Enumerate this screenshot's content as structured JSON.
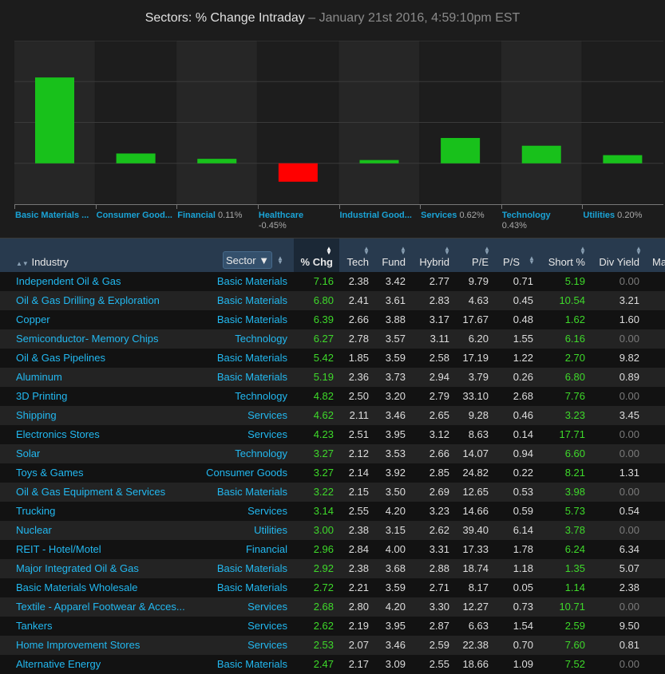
{
  "title": {
    "main": "Sectors: % Change Intraday",
    "separator": " – ",
    "sub": "January 21st 2016, 4:59:10pm EST"
  },
  "chart_data": {
    "type": "bar",
    "ylim": [
      -1,
      3
    ],
    "grid": true,
    "colors": {
      "positive": "#18c11b",
      "negative": "#ff0000"
    },
    "categories": [
      "Basic Materials ...",
      "Consumer Good...",
      "Financial",
      "Healthcare",
      "Industrial Good...",
      "Services",
      "Technology",
      "Utilities"
    ],
    "value_labels": [
      "",
      "",
      "0.11%",
      "-0.45%",
      "",
      "0.62%",
      "0.43%",
      "0.20%"
    ],
    "values": [
      2.1,
      0.24,
      0.11,
      -0.45,
      0.08,
      0.62,
      0.43,
      0.2
    ]
  },
  "table": {
    "headers": {
      "industry": "Industry",
      "sector": "Sector",
      "chg": "% Chg",
      "tech": "Tech",
      "fund": "Fund",
      "hybrid": "Hybrid",
      "pe": "P/E",
      "ps": "P/S",
      "short": "Short %",
      "div": "Div Yield",
      "more": "Ma"
    },
    "rows": [
      [
        "Independent Oil & Gas",
        "Basic Materials",
        "7.16",
        "2.38",
        "3.42",
        "2.77",
        "9.79",
        "0.71",
        "5.19",
        "0.00"
      ],
      [
        "Oil & Gas Drilling & Exploration",
        "Basic Materials",
        "6.80",
        "2.41",
        "3.61",
        "2.83",
        "4.63",
        "0.45",
        "10.54",
        "3.21"
      ],
      [
        "Copper",
        "Basic Materials",
        "6.39",
        "2.66",
        "3.88",
        "3.17",
        "17.67",
        "0.48",
        "1.62",
        "1.60"
      ],
      [
        "Semiconductor- Memory Chips",
        "Technology",
        "6.27",
        "2.78",
        "3.57",
        "3.11",
        "6.20",
        "1.55",
        "6.16",
        "0.00"
      ],
      [
        "Oil & Gas Pipelines",
        "Basic Materials",
        "5.42",
        "1.85",
        "3.59",
        "2.58",
        "17.19",
        "1.22",
        "2.70",
        "9.82"
      ],
      [
        "Aluminum",
        "Basic Materials",
        "5.19",
        "2.36",
        "3.73",
        "2.94",
        "3.79",
        "0.26",
        "6.80",
        "0.89"
      ],
      [
        "3D Printing",
        "Technology",
        "4.82",
        "2.50",
        "3.20",
        "2.79",
        "33.10",
        "2.68",
        "7.76",
        "0.00"
      ],
      [
        "Shipping",
        "Services",
        "4.62",
        "2.11",
        "3.46",
        "2.65",
        "9.28",
        "0.46",
        "3.23",
        "3.45"
      ],
      [
        "Electronics Stores",
        "Services",
        "4.23",
        "2.51",
        "3.95",
        "3.12",
        "8.63",
        "0.14",
        "17.71",
        "0.00"
      ],
      [
        "Solar",
        "Technology",
        "3.27",
        "2.12",
        "3.53",
        "2.66",
        "14.07",
        "0.94",
        "6.60",
        "0.00"
      ],
      [
        "Toys & Games",
        "Consumer Goods",
        "3.27",
        "2.14",
        "3.92",
        "2.85",
        "24.82",
        "0.22",
        "8.21",
        "1.31"
      ],
      [
        "Oil & Gas Equipment & Services",
        "Basic Materials",
        "3.22",
        "2.15",
        "3.50",
        "2.69",
        "12.65",
        "0.53",
        "3.98",
        "0.00"
      ],
      [
        "Trucking",
        "Services",
        "3.14",
        "2.55",
        "4.20",
        "3.23",
        "14.66",
        "0.59",
        "5.73",
        "0.54"
      ],
      [
        "Nuclear",
        "Utilities",
        "3.00",
        "2.38",
        "3.15",
        "2.62",
        "39.40",
        "6.14",
        "3.78",
        "0.00"
      ],
      [
        "REIT - Hotel/Motel",
        "Financial",
        "2.96",
        "2.84",
        "4.00",
        "3.31",
        "17.33",
        "1.78",
        "6.24",
        "6.34"
      ],
      [
        "Major Integrated Oil & Gas",
        "Basic Materials",
        "2.92",
        "2.38",
        "3.68",
        "2.88",
        "18.74",
        "1.18",
        "1.35",
        "5.07"
      ],
      [
        "Basic Materials Wholesale",
        "Basic Materials",
        "2.72",
        "2.21",
        "3.59",
        "2.71",
        "8.17",
        "0.05",
        "1.14",
        "2.38"
      ],
      [
        "Textile - Apparel Footwear & Acces...",
        "Services",
        "2.68",
        "2.80",
        "4.20",
        "3.30",
        "12.27",
        "0.73",
        "10.71",
        "0.00"
      ],
      [
        "Tankers",
        "Services",
        "2.62",
        "2.19",
        "3.95",
        "2.87",
        "6.63",
        "1.54",
        "2.59",
        "9.50"
      ],
      [
        "Home Improvement Stores",
        "Services",
        "2.53",
        "2.07",
        "3.46",
        "2.59",
        "22.38",
        "0.70",
        "7.60",
        "0.81"
      ],
      [
        "Alternative Energy",
        "Basic Materials",
        "2.47",
        "2.17",
        "3.09",
        "2.55",
        "18.66",
        "1.09",
        "7.52",
        "0.00"
      ]
    ]
  }
}
